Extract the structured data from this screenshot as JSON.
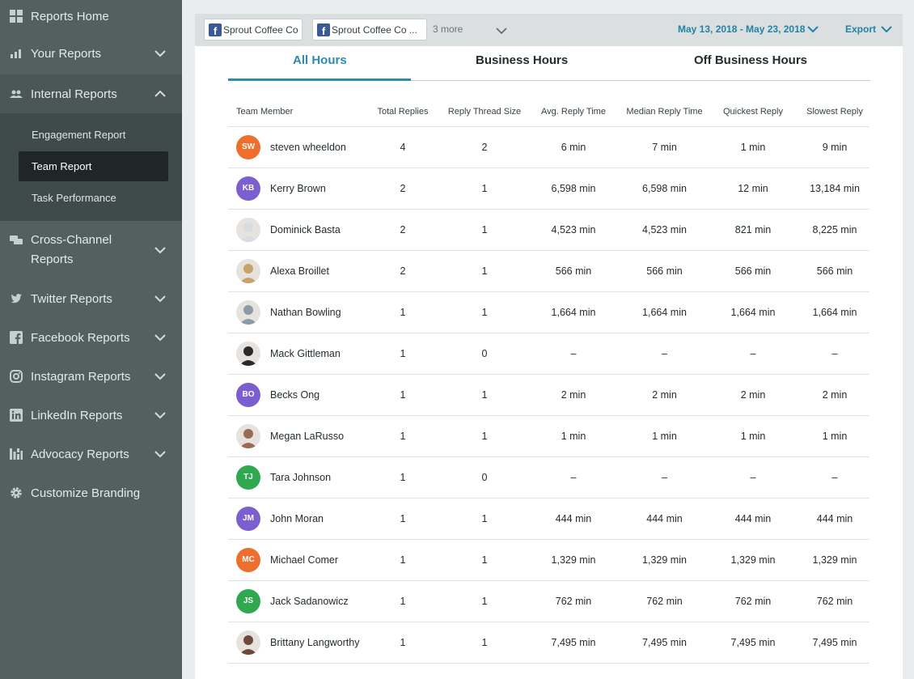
{
  "sidebar": {
    "items": [
      {
        "label": "Reports Home"
      },
      {
        "label": "Your Reports"
      },
      {
        "label": "Internal Reports"
      },
      {
        "label": "Cross-Channel"
      },
      {
        "label": "Twitter Reports"
      },
      {
        "label": "Facebook Reports"
      },
      {
        "label": "Instagram Reports"
      },
      {
        "label": "LinkedIn Reports"
      },
      {
        "label": "Advocacy Reports"
      },
      {
        "label": "Customize Branding"
      }
    ],
    "cross_channel_line2": "Reports",
    "sub_items": [
      {
        "label": "Engagement Report"
      },
      {
        "label": "Team Report"
      },
      {
        "label": "Task Performance"
      }
    ]
  },
  "topbar": {
    "profiles": [
      "Sprout Coffee Co",
      "Sprout Coffee Co ..."
    ],
    "more": "3 more",
    "date_range": "May 13, 2018 - May 23, 2018",
    "export": "Export"
  },
  "tabs": [
    "All Hours",
    "Business Hours",
    "Off Business Hours"
  ],
  "table": {
    "headers": [
      "Team Member",
      "Total Replies",
      "Reply Thread Size",
      "Avg. Reply Time",
      "Median Reply Time",
      "Quickest Reply",
      "Slowest Reply"
    ],
    "rows": [
      {
        "initials": "SW",
        "avatar_color": "#ee6e2e",
        "name": "steven wheeldon",
        "total": "4",
        "thread": "2",
        "avg": "6 min",
        "median": "7 min",
        "quick": "1 min",
        "slow": "9 min"
      },
      {
        "initials": "KB",
        "avatar_color": "#7b5ecf",
        "name": "Kerry Brown",
        "total": "2",
        "thread": "1",
        "avg": "6,598 min",
        "median": "6,598 min",
        "quick": "12 min",
        "slow": "13,184 min"
      },
      {
        "initials": "",
        "avatar_color": "#d8dde2",
        "name": "Dominick Basta",
        "total": "2",
        "thread": "1",
        "avg": "4,523 min",
        "median": "4,523 min",
        "quick": "821 min",
        "slow": "8,225 min"
      },
      {
        "initials": "",
        "avatar_color": "#c9a26b",
        "name": "Alexa Broillet",
        "total": "2",
        "thread": "1",
        "avg": "566 min",
        "median": "566 min",
        "quick": "566 min",
        "slow": "566 min"
      },
      {
        "initials": "",
        "avatar_color": "#8a9aa8",
        "name": "Nathan Bowling",
        "total": "1",
        "thread": "1",
        "avg": "1,664 min",
        "median": "1,664 min",
        "quick": "1,664 min",
        "slow": "1,664 min"
      },
      {
        "initials": "",
        "avatar_color": "#2a2a2a",
        "name": "Mack Gittleman",
        "total": "1",
        "thread": "0",
        "avg": "–",
        "median": "–",
        "quick": "–",
        "slow": "–"
      },
      {
        "initials": "BO",
        "avatar_color": "#7b5ecf",
        "name": "Becks Ong",
        "total": "1",
        "thread": "1",
        "avg": "2 min",
        "median": "2 min",
        "quick": "2 min",
        "slow": "2 min"
      },
      {
        "initials": "",
        "avatar_color": "#9b6a55",
        "name": "Megan LaRusso",
        "total": "1",
        "thread": "1",
        "avg": "1 min",
        "median": "1 min",
        "quick": "1 min",
        "slow": "1 min"
      },
      {
        "initials": "TJ",
        "avatar_color": "#2fa84f",
        "name": "Tara Johnson",
        "total": "1",
        "thread": "0",
        "avg": "–",
        "median": "–",
        "quick": "–",
        "slow": "–"
      },
      {
        "initials": "JM",
        "avatar_color": "#7b5ecf",
        "name": "John Moran",
        "total": "1",
        "thread": "1",
        "avg": "444 min",
        "median": "444 min",
        "quick": "444 min",
        "slow": "444 min"
      },
      {
        "initials": "MC",
        "avatar_color": "#ee6e2e",
        "name": "Michael Comer",
        "total": "1",
        "thread": "1",
        "avg": "1,329 min",
        "median": "1,329 min",
        "quick": "1,329 min",
        "slow": "1,329 min"
      },
      {
        "initials": "JS",
        "avatar_color": "#2fa84f",
        "name": "Jack Sadanowicz",
        "total": "1",
        "thread": "1",
        "avg": "762 min",
        "median": "762 min",
        "quick": "762 min",
        "slow": "762 min"
      },
      {
        "initials": "",
        "avatar_color": "#6b4a3a",
        "name": "Brittany Langworthy",
        "total": "1",
        "thread": "1",
        "avg": "7,495 min",
        "median": "7,495 min",
        "quick": "7,495 min",
        "slow": "7,495 min"
      }
    ]
  }
}
